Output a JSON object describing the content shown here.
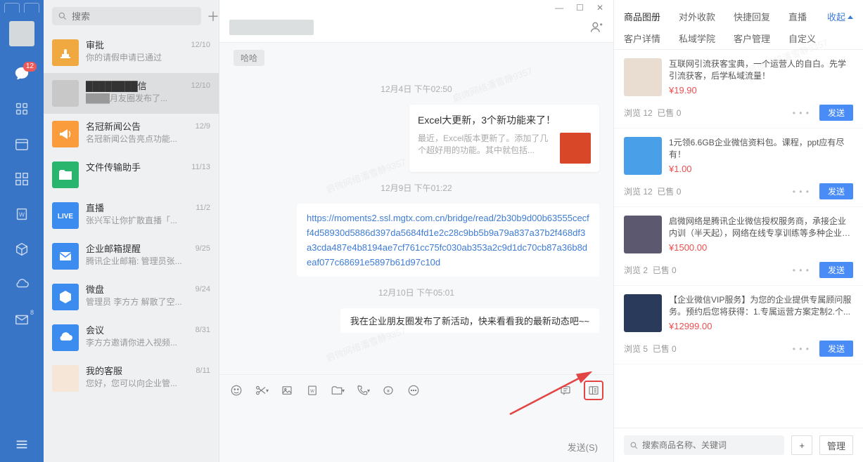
{
  "sidebar": {
    "chat_badge": "12",
    "mail_sup": "8"
  },
  "search": {
    "placeholder": "搜索"
  },
  "conversations": [
    {
      "title": "审批",
      "preview": "你的请假申请已通过",
      "date": "12/10",
      "avatar_bg": "#f0a840",
      "icon": "stamp"
    },
    {
      "title": "████████信",
      "preview": "████月友圈发布了...",
      "date": "12/10",
      "avatar_bg": "#c8c8c8",
      "active": true
    },
    {
      "title": "名冠新闻公告",
      "preview": "名冠新闻公告亮点功能...",
      "date": "12/9",
      "avatar_bg": "#fa9b3c",
      "icon": "horn"
    },
    {
      "title": "文件传输助手",
      "preview": "",
      "date": "11/13",
      "avatar_bg": "#2ab56f",
      "icon": "folder"
    },
    {
      "title": "直播",
      "preview": "张兴军让你扩散直播「...",
      "date": "11/2",
      "avatar_bg": "#3c8cf0",
      "icon": "live"
    },
    {
      "title": "企业邮箱提醒",
      "preview": "腾讯企业邮箱: 管理员张...",
      "date": "9/25",
      "avatar_bg": "#3c8cf0",
      "icon": "mail"
    },
    {
      "title": "微盘",
      "preview": "管理员 李方方 解散了空...",
      "date": "9/24",
      "avatar_bg": "#3c8cf0",
      "icon": "disk"
    },
    {
      "title": "会议",
      "preview": "李方方邀请你进入视频...",
      "date": "8/31",
      "avatar_bg": "#3c8cf0",
      "icon": "cloud"
    },
    {
      "title": "我的客服",
      "preview": "您好，您可以向企业管...",
      "date": "8/11",
      "avatar_bg": "#f5e6d8",
      "icon": "person"
    }
  ],
  "chat": {
    "chip": "哈哈",
    "ts1": "12月4日 下午02:50",
    "card": {
      "title": "Excel大更新，3个新功能来了！",
      "desc": "最近，Excel版本更新了。添加了几个超好用的功能。其中就包括..."
    },
    "ts2": "12月9日 下午01:22",
    "link": "https://moments2.ssl.mgtx.com.cn/bridge/read/2b30b9d00b63555cecff4d58930d5886d397da5684fd1e2c28c9bb5b9a79a837a37b2f468df3a3cda487e4b8194ae7cf761cc75fc030ab353a2c9d1dc70cb87a36b8deaf077c68691e5897b61d97c10d",
    "ts3": "12月10日 下午05:01",
    "msg": "我在企业朋友圈发布了新活动，快来看看我的最新动态吧~~",
    "send_label": "发送(S)"
  },
  "right": {
    "tabs_row1": [
      "商品图册",
      "对外收款",
      "快捷回复",
      "直播"
    ],
    "tabs_row2": [
      "客户详情",
      "私域学院",
      "客户管理",
      "自定义"
    ],
    "collapse": "收起",
    "products": [
      {
        "title": "互联网引流获客宝典，一个运营人的自白。先学引流获客，后学私域流量！",
        "price": "¥19.90",
        "views": "浏览 12",
        "sold": "已售 0",
        "send": "发送"
      },
      {
        "title": "1元领6.6GB企业微信资料包。课程，ppt应有尽有！",
        "price": "¥1.00",
        "views": "浏览 12",
        "sold": "已售 0",
        "send": "发送"
      },
      {
        "title": "启微网络是腾讯企业微信授权服务商，承接企业内训（半天起），网络在线专享训练等多种企业培...",
        "price": "¥1500.00",
        "views": "浏览 2",
        "sold": "已售 0",
        "send": "发送"
      },
      {
        "title": "【企业微信VIP服务】为您的企业提供专属顾问服务。预约后您将获得：1.专属运营方案定制2.个...",
        "price": "¥12999.00",
        "views": "浏览 5",
        "sold": "已售 0",
        "send": "发送"
      }
    ],
    "search_placeholder": "搜索商品名称、关键词",
    "add": "+",
    "manage": "管理"
  },
  "watermark": "启微网络潘雪静9357"
}
